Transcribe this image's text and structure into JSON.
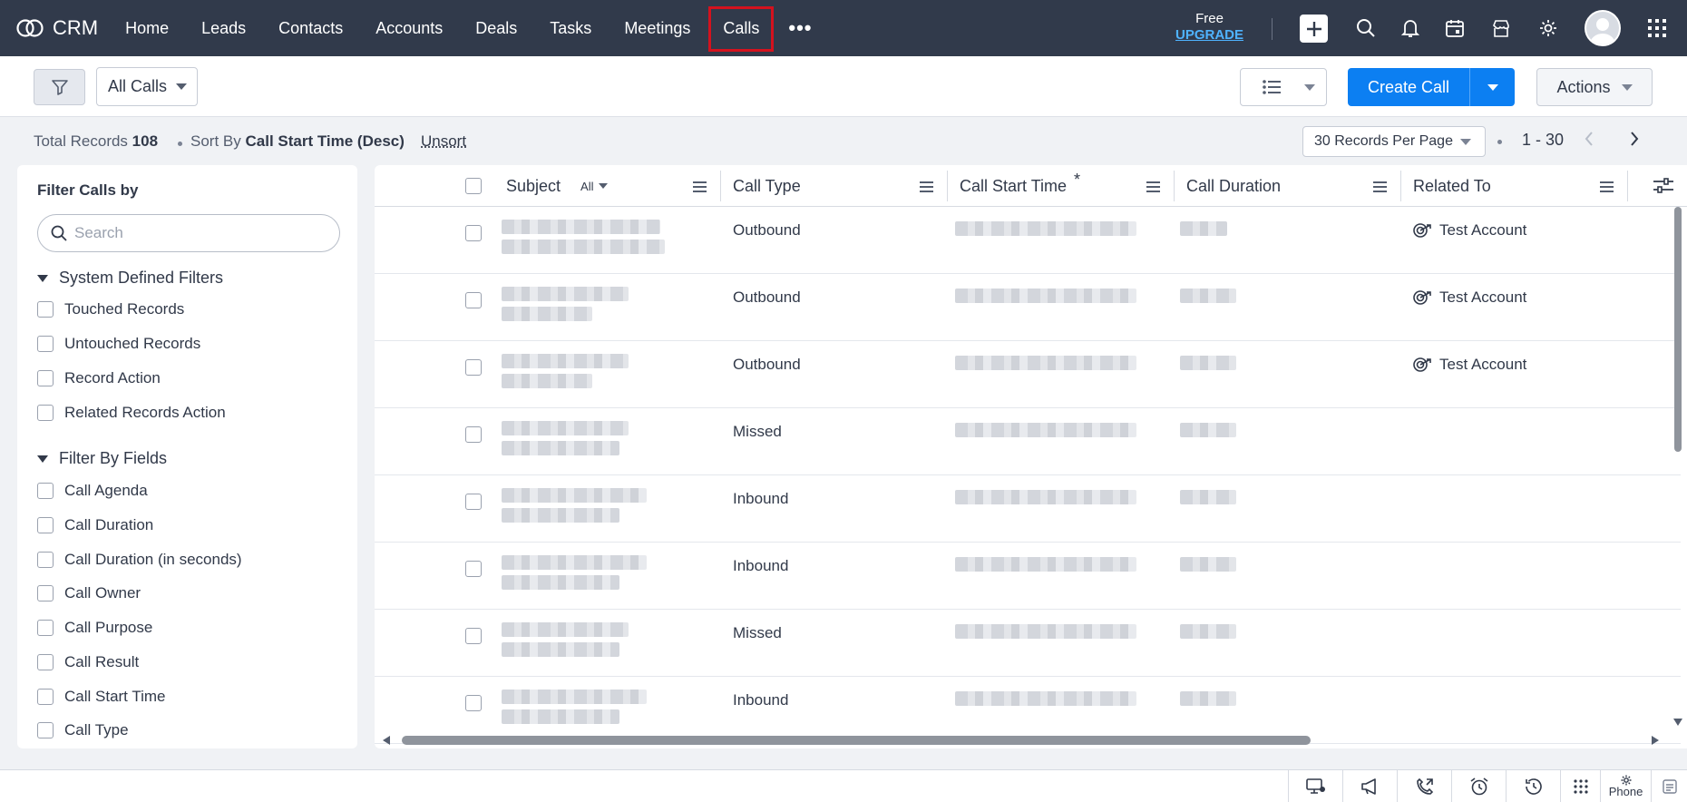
{
  "nav": {
    "brand": "CRM",
    "tabs": [
      {
        "label": "Home"
      },
      {
        "label": "Leads"
      },
      {
        "label": "Contacts"
      },
      {
        "label": "Accounts"
      },
      {
        "label": "Deals"
      },
      {
        "label": "Tasks"
      },
      {
        "label": "Meetings"
      },
      {
        "label": "Calls",
        "active": true
      }
    ],
    "more": "•••",
    "plan": "Free",
    "upgrade": "UPGRADE"
  },
  "toolbar": {
    "view_label": "All Calls",
    "create_label": "Create Call",
    "actions_label": "Actions"
  },
  "info": {
    "total_label": "Total Records",
    "total_value": "108",
    "sort_label": "Sort By",
    "sort_value": "Call Start Time (Desc)",
    "unsort": "Unsort",
    "per_page": "30 Records Per Page",
    "range": "1 - 30"
  },
  "filters": {
    "title": "Filter Calls by",
    "search_placeholder": "Search",
    "system_title": "System Defined Filters",
    "system_items": [
      "Touched Records",
      "Untouched Records",
      "Record Action",
      "Related Records Action"
    ],
    "fields_title": "Filter By Fields",
    "field_items": [
      "Call Agenda",
      "Call Duration",
      "Call Duration (in seconds)",
      "Call Owner",
      "Call Purpose",
      "Call Result",
      "Call Start Time",
      "Call Type"
    ]
  },
  "table": {
    "columns": {
      "subject": "Subject",
      "subject_filter": "All",
      "call_type": "Call Type",
      "call_start": "Call Start Time",
      "call_start_marker": "*",
      "call_duration": "Call Duration",
      "related_to": "Related To"
    },
    "rows": [
      {
        "call_type": "Outbound",
        "related_to": "Test Account"
      },
      {
        "call_type": "Outbound",
        "related_to": "Test Account"
      },
      {
        "call_type": "Outbound",
        "related_to": "Test Account"
      },
      {
        "call_type": "Missed",
        "related_to": ""
      },
      {
        "call_type": "Inbound",
        "related_to": ""
      },
      {
        "call_type": "Inbound",
        "related_to": ""
      },
      {
        "call_type": "Missed",
        "related_to": ""
      },
      {
        "call_type": "Inbound",
        "related_to": ""
      }
    ]
  },
  "bottombar": {
    "phone_label": "Phone"
  },
  "colors": {
    "nav_bg": "#313a4b",
    "primary": "#0c7ff2",
    "highlight": "#d4121e",
    "upgrade": "#4fb3ff"
  }
}
